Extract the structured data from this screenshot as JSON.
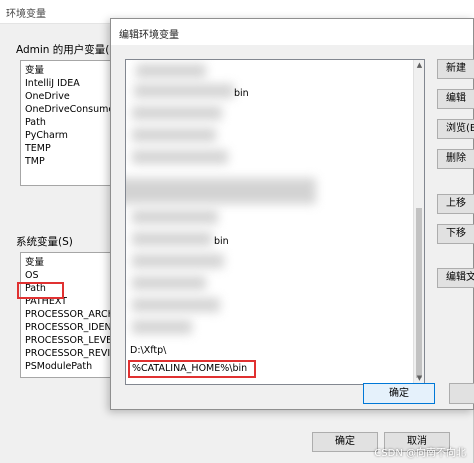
{
  "back_dialog": {
    "title": "环境变量",
    "user_section_label": "Admin 的用户变量(U)",
    "user_vars": [
      "变量",
      "IntelliJ IDEA",
      "OneDrive",
      "OneDriveConsumer",
      "Path",
      "PyCharm",
      "TEMP",
      "TMP"
    ],
    "system_section_label": "系统变量(S)",
    "system_vars": [
      "变量",
      "OS",
      "Path",
      "PATHEXT",
      "PROCESSOR_ARCHI",
      "PROCESSOR_IDENT",
      "PROCESSOR_LEVEL",
      "PROCESSOR_REVISI",
      "PSModulePath"
    ],
    "ok_label": "确定",
    "cancel_label": "取消"
  },
  "edit_dialog": {
    "title": "编辑环境变量",
    "visible_entries": [
      "D:\\Xftp\\",
      "%CATALINA_HOME%\\bin"
    ],
    "fragments": [
      "bin",
      "bin"
    ],
    "buttons": [
      "新建",
      "编辑",
      "浏览(B)",
      "删除",
      "上移",
      "下移",
      "编辑文本"
    ],
    "ok_label": "确定"
  },
  "watermark": "CSDN @向南不向北"
}
